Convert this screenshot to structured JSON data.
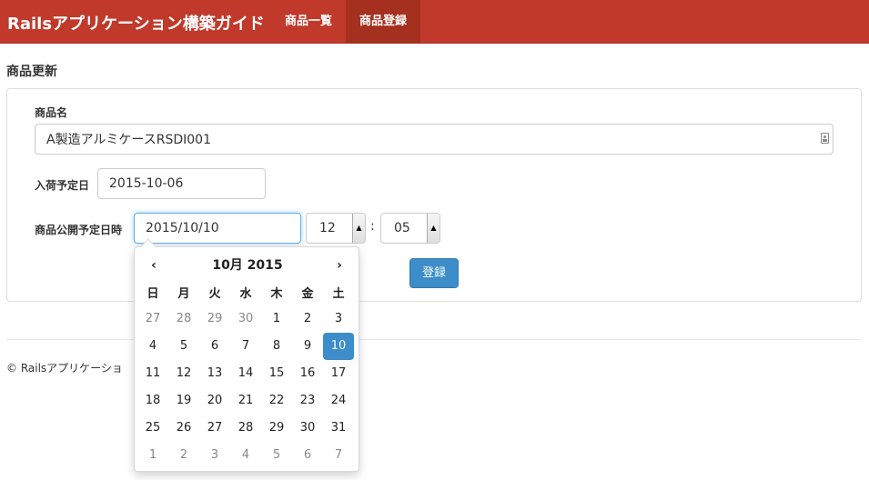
{
  "navbar": {
    "brand": "Railsアプリケーション構築ガイド",
    "items": [
      {
        "label": "商品一覧",
        "active": false
      },
      {
        "label": "商品登録",
        "active": true
      }
    ],
    "color": "#c0392b"
  },
  "page": {
    "title": "商品更新"
  },
  "form": {
    "product_name_label": "商品名",
    "product_name_value": "A製造アルミケースRSDI001",
    "arrival_label": "入荷予定日",
    "arrival_value": "2015-10-06",
    "publish_label": "商品公開予定日時",
    "publish_date_value": "2015/10/10",
    "hour_value": "12",
    "minute_value": "05",
    "time_separator": ":",
    "submit_label": "登録",
    "accent_color": "#3c8dc9"
  },
  "footer": {
    "text": "© Railsアプリケーショ"
  },
  "datepicker": {
    "prev_glyph": "‹",
    "next_glyph": "›",
    "title": "10月 2015",
    "weekdays": [
      "日",
      "月",
      "火",
      "水",
      "木",
      "金",
      "土"
    ],
    "weeks": [
      [
        {
          "d": "27",
          "other": true
        },
        {
          "d": "28",
          "other": true
        },
        {
          "d": "29",
          "other": true
        },
        {
          "d": "30",
          "other": true
        },
        {
          "d": "1"
        },
        {
          "d": "2"
        },
        {
          "d": "3"
        }
      ],
      [
        {
          "d": "4"
        },
        {
          "d": "5"
        },
        {
          "d": "6"
        },
        {
          "d": "7"
        },
        {
          "d": "8"
        },
        {
          "d": "9"
        },
        {
          "d": "10",
          "active": true
        }
      ],
      [
        {
          "d": "11"
        },
        {
          "d": "12"
        },
        {
          "d": "13"
        },
        {
          "d": "14"
        },
        {
          "d": "15"
        },
        {
          "d": "16"
        },
        {
          "d": "17"
        }
      ],
      [
        {
          "d": "18"
        },
        {
          "d": "19"
        },
        {
          "d": "20"
        },
        {
          "d": "21"
        },
        {
          "d": "22"
        },
        {
          "d": "23"
        },
        {
          "d": "24"
        }
      ],
      [
        {
          "d": "25"
        },
        {
          "d": "26"
        },
        {
          "d": "27"
        },
        {
          "d": "28"
        },
        {
          "d": "29"
        },
        {
          "d": "30"
        },
        {
          "d": "31"
        }
      ],
      [
        {
          "d": "1",
          "other": true
        },
        {
          "d": "2",
          "other": true
        },
        {
          "d": "3",
          "other": true
        },
        {
          "d": "4",
          "other": true
        },
        {
          "d": "5",
          "other": true
        },
        {
          "d": "6",
          "other": true
        },
        {
          "d": "7",
          "other": true
        }
      ]
    ]
  }
}
